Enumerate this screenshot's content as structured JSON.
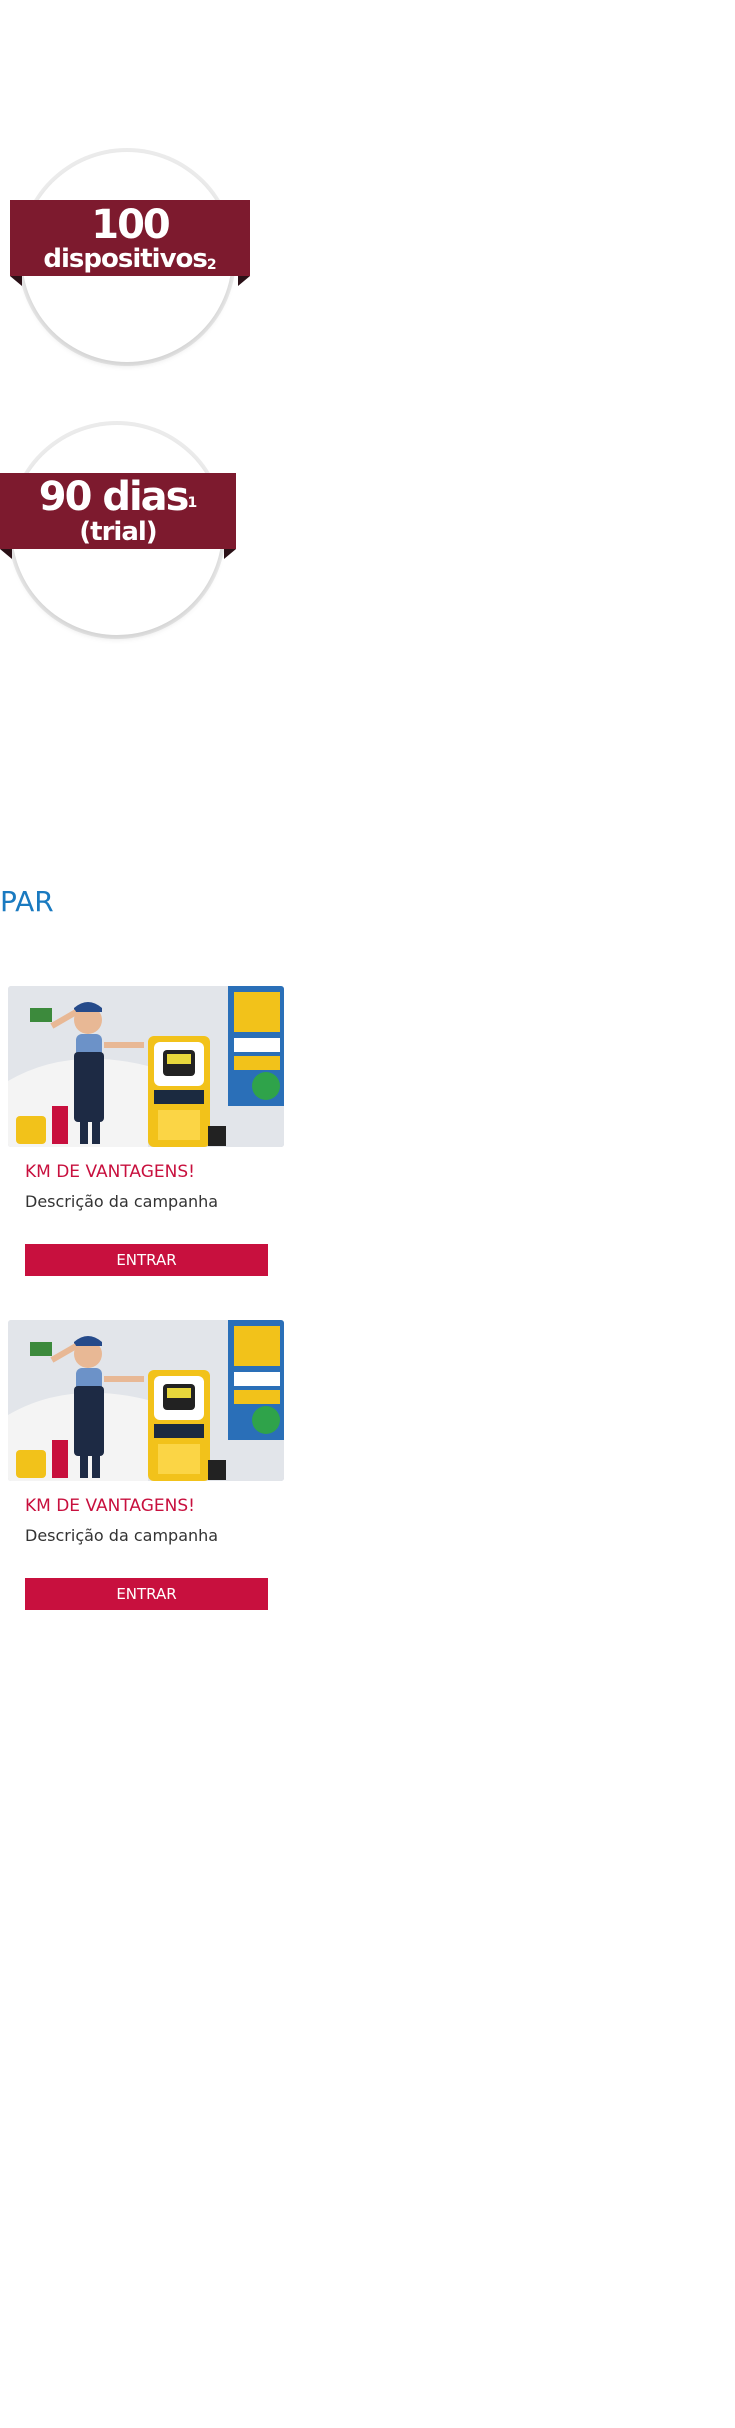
{
  "badges": [
    {
      "number": "100",
      "label": "dispositivos",
      "sup": "2"
    },
    {
      "number": "90 dias",
      "sup": "1",
      "label": "(trial)"
    }
  ],
  "section": {
    "title": "PAR"
  },
  "campaigns": [
    {
      "title": "KM DE VANTAGENS!",
      "description": "Descrição da campanha",
      "button": "ENTRAR"
    },
    {
      "title": "KM DE VANTAGENS!",
      "description": "Descrição da campanha",
      "button": "ENTRAR"
    }
  ],
  "colors": {
    "ribbon": "#7d1a2e",
    "accent": "#c8103e",
    "link": "#1a7ac0"
  }
}
